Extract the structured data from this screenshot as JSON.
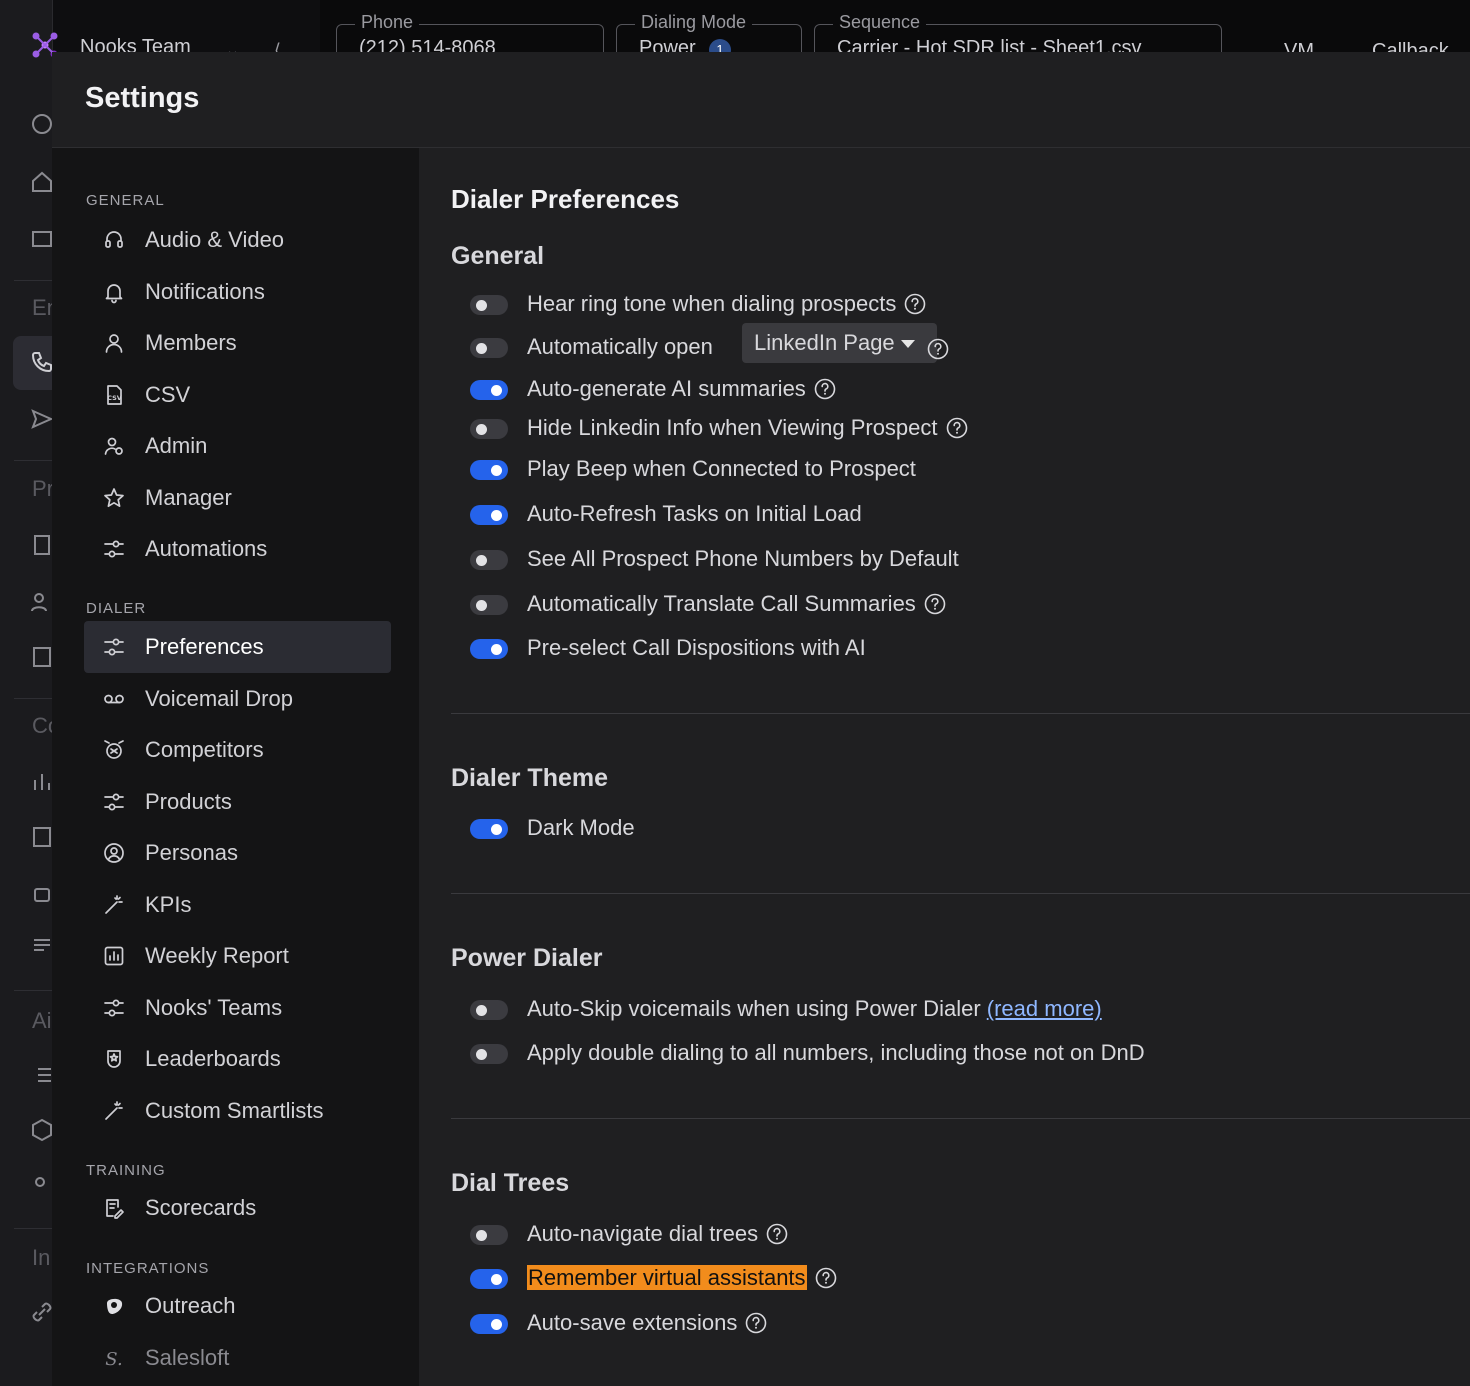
{
  "app": {
    "team_name": "Nooks Team",
    "rail_section_letters": [
      "En",
      "Pr",
      "Co",
      "Ai",
      "In"
    ]
  },
  "topbar": {
    "phone_label": "Phone",
    "phone_value": "(212) 514-8068",
    "dialing_mode_label": "Dialing Mode",
    "dialing_mode_value": "Power",
    "dialing_mode_badge": "1",
    "sequence_label": "Sequence",
    "sequence_value": "Carrier - Hot SDR list - Sheet1.csv",
    "vm_label": "VM",
    "callback_label": "Callback"
  },
  "settings": {
    "title": "Settings",
    "nav": {
      "general_header": "GENERAL",
      "general": [
        {
          "label": "Audio & Video",
          "icon": "headset-icon"
        },
        {
          "label": "Notifications",
          "icon": "bell-icon"
        },
        {
          "label": "Members",
          "icon": "user-icon"
        },
        {
          "label": "CSV",
          "icon": "csv-file-icon"
        },
        {
          "label": "Admin",
          "icon": "admin-user-icon"
        },
        {
          "label": "Manager",
          "icon": "star-icon"
        },
        {
          "label": "Automations",
          "icon": "sliders-icon"
        }
      ],
      "dialer_header": "DIALER",
      "dialer": [
        {
          "label": "Preferences",
          "icon": "sliders-icon",
          "active": true
        },
        {
          "label": "Voicemail Drop",
          "icon": "voicemail-icon"
        },
        {
          "label": "Competitors",
          "icon": "competitors-icon"
        },
        {
          "label": "Products",
          "icon": "sliders-icon"
        },
        {
          "label": "Personas",
          "icon": "persona-icon"
        },
        {
          "label": "KPIs",
          "icon": "magic-wand-icon"
        },
        {
          "label": "Weekly Report",
          "icon": "bar-chart-icon"
        },
        {
          "label": "Nooks' Teams",
          "icon": "sliders-icon"
        },
        {
          "label": "Leaderboards",
          "icon": "leaderboard-icon"
        },
        {
          "label": "Custom Smartlists",
          "icon": "magic-wand-icon"
        }
      ],
      "training_header": "TRAINING",
      "training": [
        {
          "label": "Scorecards",
          "icon": "scorecard-icon"
        }
      ],
      "integrations_header": "INTEGRATIONS",
      "integrations": [
        {
          "label": "Outreach",
          "icon": "outreach-icon"
        },
        {
          "label": "Salesloft",
          "icon": "salesloft-icon"
        }
      ]
    },
    "content": {
      "heading": "Dialer Preferences",
      "general_title": "General",
      "general": [
        {
          "label": "Hear ring tone when dialing prospects",
          "on": false,
          "help": true
        },
        {
          "label": "Automatically open",
          "on": false,
          "help": true,
          "dropdown": "LinkedIn Page"
        },
        {
          "label": "Auto-generate AI summaries",
          "on": true,
          "help": true
        },
        {
          "label": "Hide Linkedin Info when Viewing Prospect",
          "on": false,
          "help": true
        },
        {
          "label": "Play Beep when Connected to Prospect",
          "on": true,
          "help": false
        },
        {
          "label": "Auto-Refresh Tasks on Initial Load",
          "on": true,
          "help": false
        },
        {
          "label": "See All Prospect Phone Numbers by Default",
          "on": false,
          "help": false
        },
        {
          "label": "Automatically Translate Call Summaries",
          "on": false,
          "help": true
        },
        {
          "label": "Pre-select Call Dispositions with AI",
          "on": true,
          "help": false
        }
      ],
      "theme_title": "Dialer Theme",
      "theme": [
        {
          "label": "Dark Mode",
          "on": true
        }
      ],
      "power_title": "Power Dialer",
      "power": [
        {
          "label": "Auto-Skip voicemails when using Power Dialer",
          "on": false,
          "link": "(read more)"
        },
        {
          "label": "Apply double dialing to all numbers, including those not on DnD",
          "on": false
        }
      ],
      "dialtrees_title": "Dial Trees",
      "dialtrees": [
        {
          "label": "Auto-navigate dial trees",
          "on": false,
          "help": true
        },
        {
          "label": "Remember virtual assistants",
          "on": true,
          "help": true,
          "highlighted": true
        },
        {
          "label": "Auto-save extensions",
          "on": true,
          "help": true
        }
      ]
    }
  },
  "colors": {
    "toggle_on": "#2563eb",
    "toggle_off": "#3b3b40",
    "highlight": "#f28c1c",
    "link": "#8fb7ff"
  }
}
